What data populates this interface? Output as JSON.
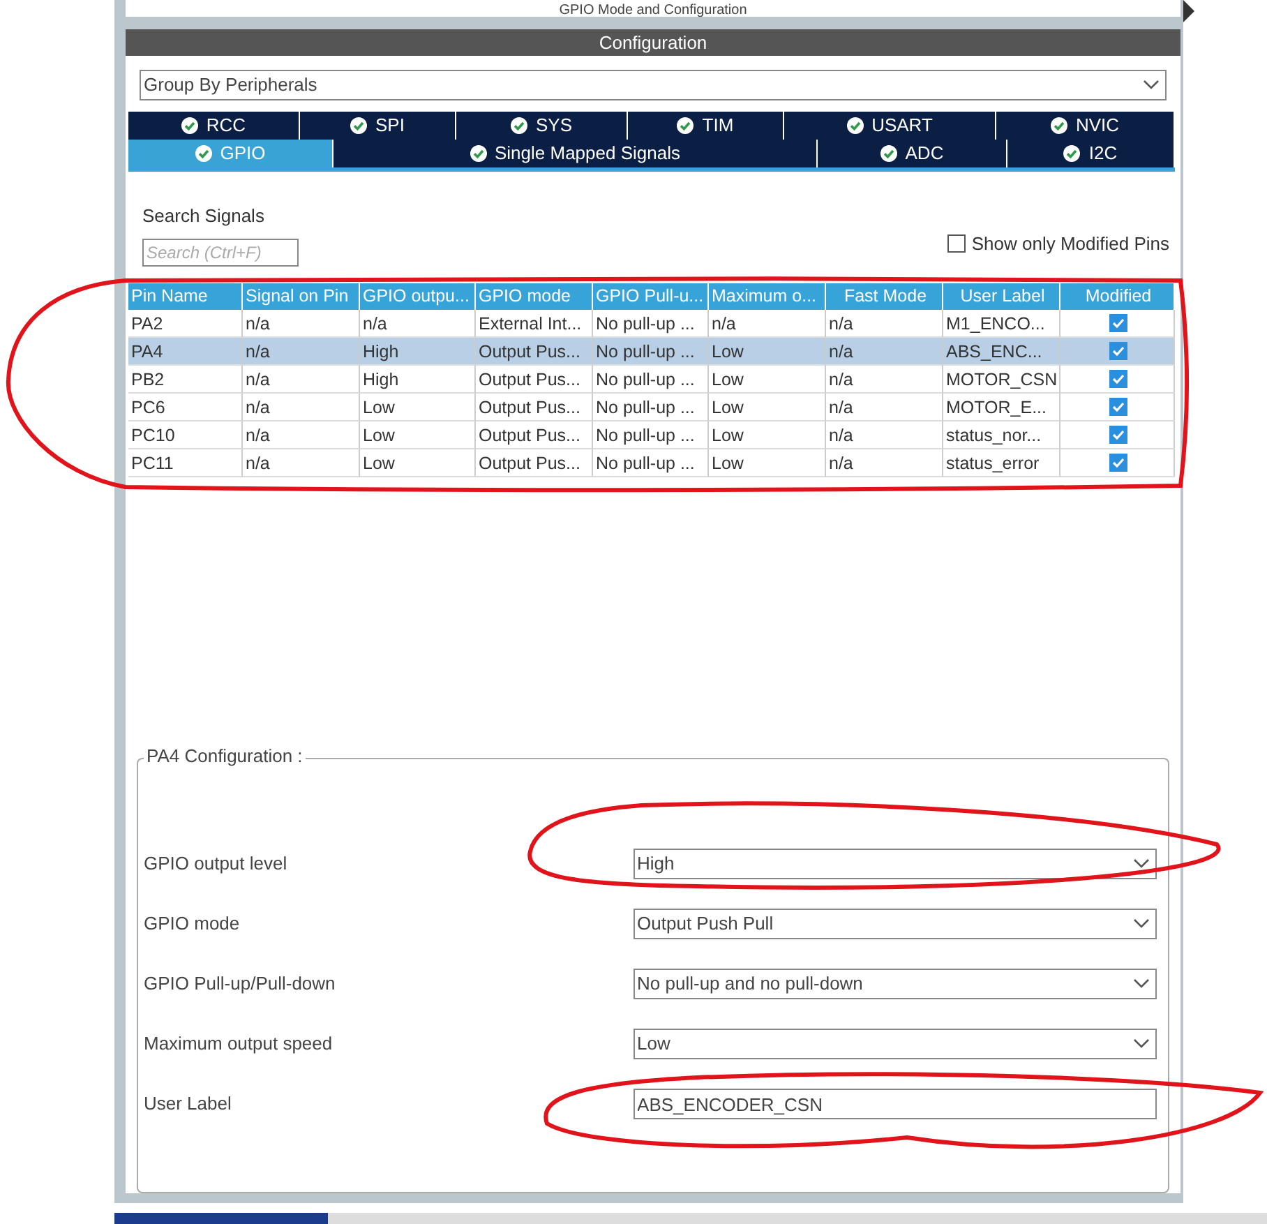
{
  "header": {
    "title": "GPIO Mode and Configuration"
  },
  "configuration": {
    "title": "Configuration",
    "group_by": {
      "value": "Group By Peripherals"
    },
    "tab_rows": [
      [
        {
          "label": "RCC",
          "selected": false
        },
        {
          "label": "SPI",
          "selected": false
        },
        {
          "label": "SYS",
          "selected": false
        },
        {
          "label": "TIM",
          "selected": false
        },
        {
          "label": "USART",
          "selected": false
        },
        {
          "label": "NVIC",
          "selected": false
        }
      ],
      [
        {
          "label": "GPIO",
          "selected": true
        },
        {
          "label": "Single Mapped Signals",
          "selected": false
        },
        {
          "label": "ADC",
          "selected": false
        },
        {
          "label": "I2C",
          "selected": false
        }
      ]
    ],
    "search": {
      "label": "Search Signals",
      "placeholder": "Search (Ctrl+F)"
    },
    "show_only_modified": {
      "label": "Show only Modified Pins",
      "checked": false
    },
    "table": {
      "columns": [
        "Pin Name",
        "Signal on Pin",
        "GPIO outpu...",
        "GPIO mode",
        "GPIO Pull-u...",
        "Maximum o...",
        "Fast Mode",
        "User Label",
        "Modified"
      ],
      "rows": [
        {
          "cells": [
            "PA2",
            "n/a",
            "n/a",
            "External Int...",
            "No pull-up ...",
            "n/a",
            "n/a",
            "M1_ENCO..."
          ],
          "modified": true,
          "selected": false
        },
        {
          "cells": [
            "PA4",
            "n/a",
            "High",
            "Output Pus...",
            "No pull-up ...",
            "Low",
            "n/a",
            "ABS_ENC..."
          ],
          "modified": true,
          "selected": true
        },
        {
          "cells": [
            "PB2",
            "n/a",
            "High",
            "Output Pus...",
            "No pull-up ...",
            "Low",
            "n/a",
            "MOTOR_CSN"
          ],
          "modified": true,
          "selected": false
        },
        {
          "cells": [
            "PC6",
            "n/a",
            "Low",
            "Output Pus...",
            "No pull-up ...",
            "Low",
            "n/a",
            "MOTOR_E..."
          ],
          "modified": true,
          "selected": false
        },
        {
          "cells": [
            "PC10",
            "n/a",
            "Low",
            "Output Pus...",
            "No pull-up ...",
            "Low",
            "n/a",
            "status_nor..."
          ],
          "modified": true,
          "selected": false
        },
        {
          "cells": [
            "PC11",
            "n/a",
            "Low",
            "Output Pus...",
            "No pull-up ...",
            "Low",
            "n/a",
            "status_error"
          ],
          "modified": true,
          "selected": false
        }
      ]
    },
    "pin_config": {
      "title": "PA4 Configuration :",
      "fields": [
        {
          "kind": "select",
          "label": "GPIO output level",
          "value": "High"
        },
        {
          "kind": "select",
          "label": "GPIO mode",
          "value": "Output Push Pull"
        },
        {
          "kind": "select",
          "label": "GPIO Pull-up/Pull-down",
          "value": "No pull-up and no pull-down"
        },
        {
          "kind": "select",
          "label": "Maximum output speed",
          "value": "Low"
        },
        {
          "kind": "text",
          "label": "User Label",
          "value": "ABS_ENCODER_CSN"
        }
      ]
    }
  },
  "annotations": [
    {
      "kind": "loop"
    },
    {
      "kind": "loop"
    },
    {
      "kind": "loop"
    }
  ]
}
